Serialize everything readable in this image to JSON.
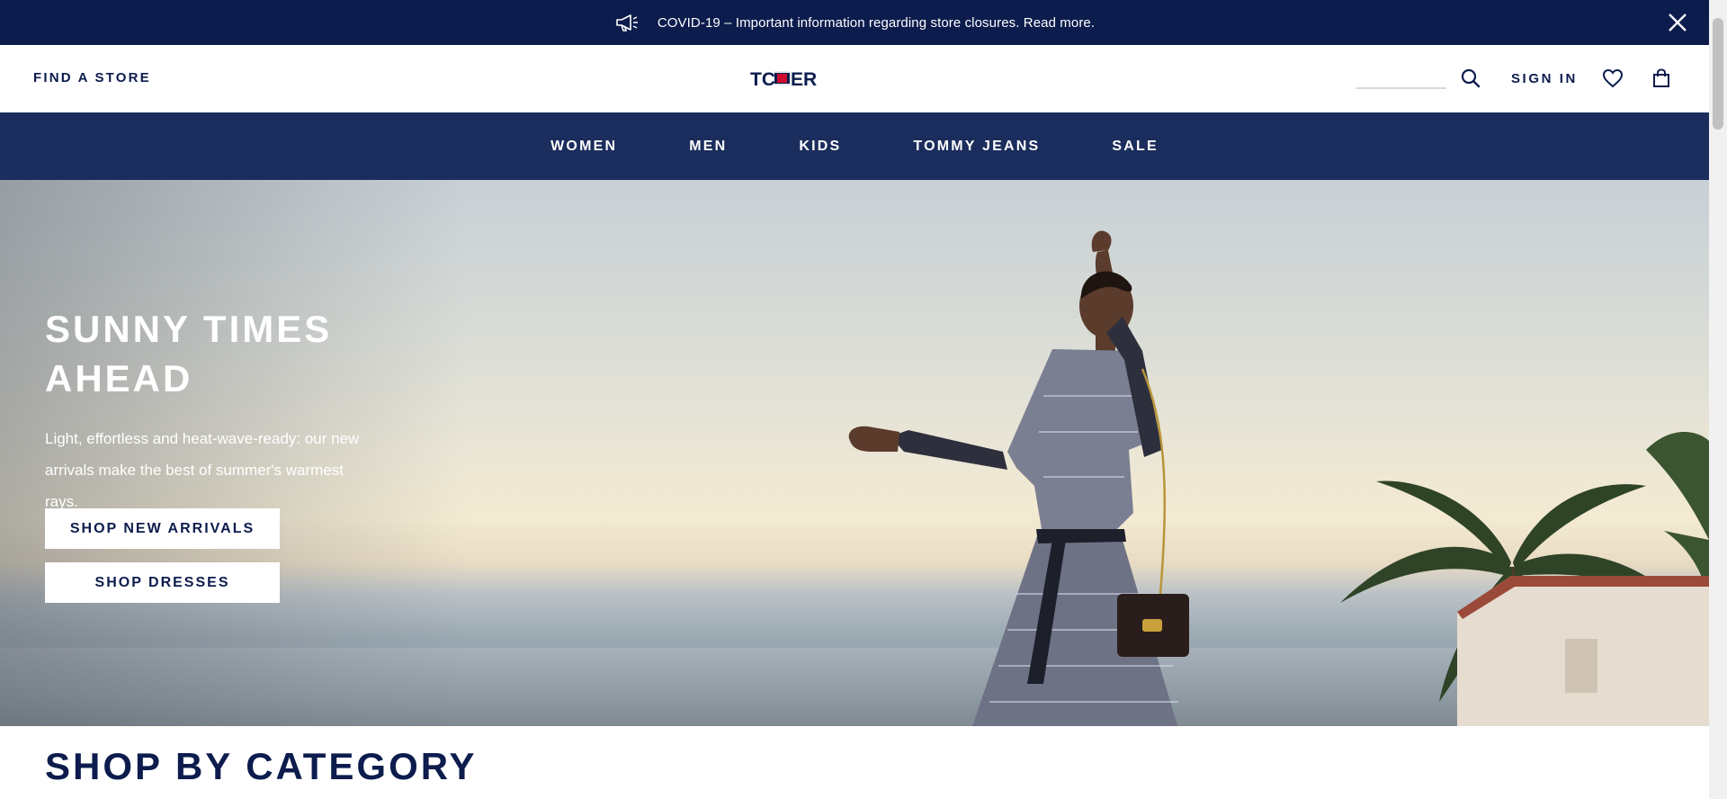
{
  "announcement": {
    "text": "COVID-19 – Important information regarding store closures. Read more."
  },
  "header": {
    "find_store": "FIND A STORE",
    "sign_in": "SIGN IN",
    "search_placeholder": ""
  },
  "nav": {
    "items": [
      {
        "label": "WOMEN"
      },
      {
        "label": "MEN"
      },
      {
        "label": "KIDS"
      },
      {
        "label": "TOMMY JEANS"
      },
      {
        "label": "SALE"
      }
    ]
  },
  "hero": {
    "title": "SUNNY TIMES\nAHEAD",
    "description": "Light, effortless and heat-wave-ready: our new arrivals make the best of summer's warmest rays.",
    "buttons": [
      {
        "label": "SHOP NEW ARRIVALS"
      },
      {
        "label": "SHOP DRESSES"
      }
    ]
  },
  "section": {
    "title": "SHOP BY CATEGORY"
  },
  "icons": {
    "announcement": "megaphone-icon",
    "close": "close-icon",
    "search": "search-icon",
    "wishlist": "heart-icon",
    "bag": "shopping-bag-icon"
  },
  "colors": {
    "navy": "#0c1c4d",
    "nav_bar": "#1b2d5c",
    "brand_red": "#cc0c2f"
  }
}
